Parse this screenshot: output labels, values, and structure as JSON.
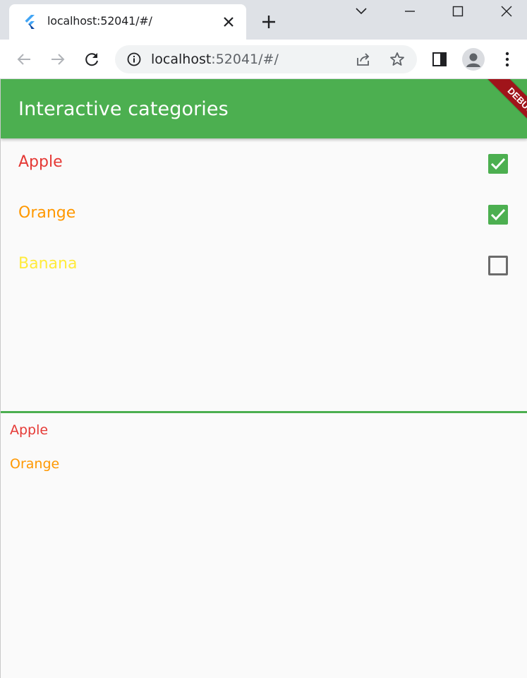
{
  "browser": {
    "tab_title": "localhost:52041/#/",
    "url_host": "localhost",
    "url_rest": ":52041/#/"
  },
  "app": {
    "title": "Interactive categories",
    "debug_banner": "DEBUG",
    "accent_color": "#4caf50"
  },
  "categories": [
    {
      "label": "Apple",
      "color": "#e53935",
      "checked": true
    },
    {
      "label": "Orange",
      "color": "#ff9800",
      "checked": true
    },
    {
      "label": "Banana",
      "color": "#ffeb3b",
      "checked": false
    }
  ],
  "selected": [
    {
      "label": "Apple",
      "color": "#e53935"
    },
    {
      "label": "Orange",
      "color": "#ff9800"
    }
  ]
}
